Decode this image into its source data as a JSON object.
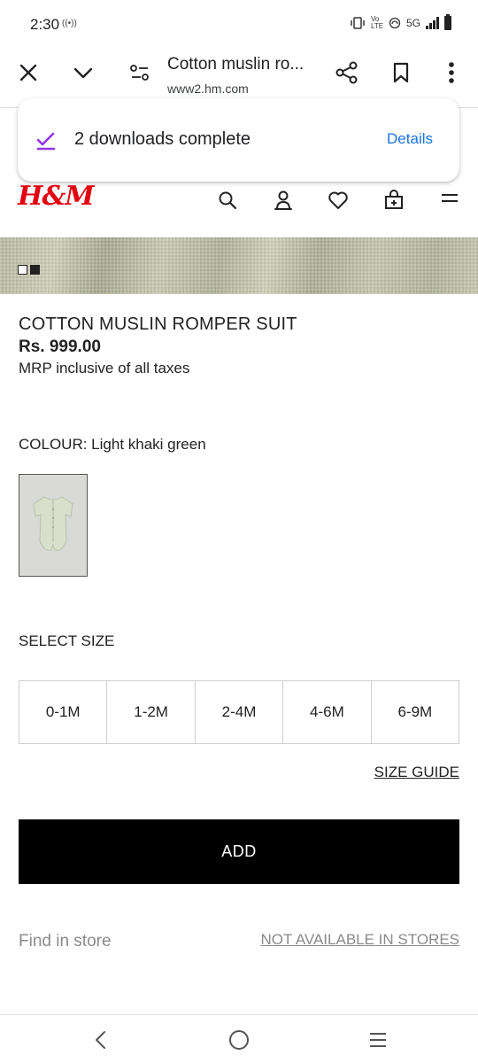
{
  "status_bar": {
    "time": "2:30",
    "hotspot_text": "((•))",
    "vibrate_icon": "vibrate-icon",
    "volte_text": "Vo​ LTE",
    "network_text": "5G",
    "signal_icon": "signal-icon",
    "battery_icon": "battery-icon"
  },
  "toolbar": {
    "title": "Cotton muslin ro...",
    "url": "www2.hm.com",
    "icons": [
      "close-icon",
      "chevron-down-icon",
      "page-settings-icon",
      "share-icon",
      "bookmark-icon",
      "more-vert-icon"
    ]
  },
  "download_popup": {
    "message": "2 downloads complete",
    "action": "Details",
    "check_color": "#9334e6"
  },
  "site_header": {
    "logo": "H&M",
    "logo_color": "#e50010",
    "icons": [
      "search-icon",
      "account-icon",
      "favorites-icon",
      "cart-icon",
      "menu-icon"
    ]
  },
  "product": {
    "name": "COTTON MUSLIN ROMPER SUIT",
    "price": "Rs. 999.00",
    "tax_note": "MRP inclusive of all taxes",
    "colour_label": "COLOUR: Light khaki green",
    "select_size_label": "SELECT SIZE",
    "sizes": [
      "0-1M",
      "1-2M",
      "2-4M",
      "4-6M",
      "6-9M"
    ],
    "size_guide": "SIZE GUIDE",
    "add_button": "ADD",
    "find_in_store": "Find in store",
    "store_status": "NOT AVAILABLE IN STORES"
  },
  "nav_bar": {
    "icons": [
      "back-icon",
      "home-icon",
      "recents-icon"
    ]
  }
}
